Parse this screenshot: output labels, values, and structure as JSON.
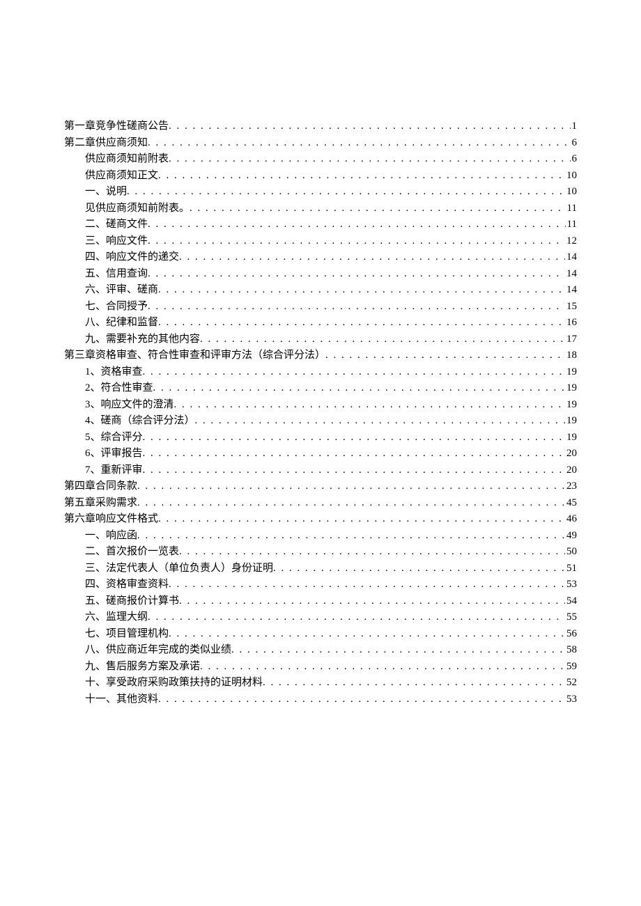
{
  "toc": [
    {
      "level": 1,
      "label": "第一章竞争性磋商公告",
      "page": "1"
    },
    {
      "level": 1,
      "label": "第二章供应商须知",
      "page": "6"
    },
    {
      "level": 2,
      "label": "供应商须知前附表",
      "page": "6"
    },
    {
      "level": 2,
      "label": "供应商须知正文",
      "page": "10"
    },
    {
      "level": 2,
      "label": "一、说明",
      "page": "10"
    },
    {
      "level": 2,
      "label": "见供应商须知前附表。",
      "page": "11"
    },
    {
      "level": 2,
      "label": "二、磋商文件",
      "page": "11"
    },
    {
      "level": 2,
      "label": "三、响应文件",
      "page": "12"
    },
    {
      "level": 2,
      "label": "四、响应文件的递交",
      "page": "14"
    },
    {
      "level": 2,
      "label": "五、信用查询",
      "page": "14"
    },
    {
      "level": 2,
      "label": "六、评审、磋商",
      "page": "14"
    },
    {
      "level": 2,
      "label": "七、合同授予",
      "page": "15"
    },
    {
      "level": 2,
      "label": "八、纪律和监督",
      "page": "16"
    },
    {
      "level": 2,
      "label": "九、需要补充的其他内容",
      "page": "17"
    },
    {
      "level": 1,
      "label": "第三章资格审查、符合性审查和评审方法（综合评分法）",
      "page": "18"
    },
    {
      "level": 2,
      "label": "1、资格审查",
      "page": "19"
    },
    {
      "level": 2,
      "label": "2、符合性审查",
      "page": "19"
    },
    {
      "level": 2,
      "label": "3、响应文件的澄清",
      "page": "19"
    },
    {
      "level": 2,
      "label": "4、磋商（综合评分法）",
      "page": "19"
    },
    {
      "level": 2,
      "label": "5、综合评分",
      "page": "19"
    },
    {
      "level": 2,
      "label": "6、评审报告",
      "page": "20"
    },
    {
      "level": 2,
      "label": "7、重新评审",
      "page": "20"
    },
    {
      "level": 1,
      "label": "第四章合同条款",
      "page": "23"
    },
    {
      "level": 1,
      "label": "第五章采购需求",
      "page": "45"
    },
    {
      "level": 1,
      "label": "第六章响应文件格式",
      "page": "46"
    },
    {
      "level": 2,
      "label": "一、响应函",
      "page": "49"
    },
    {
      "level": 2,
      "label": "二、首次报价一览表",
      "page": "50"
    },
    {
      "level": 2,
      "label": "三、法定代表人（单位负责人）身份证明",
      "page": "51"
    },
    {
      "level": 2,
      "label": "四、资格审查资料",
      "page": "53"
    },
    {
      "level": 2,
      "label": "五、磋商报价计算书",
      "page": "54"
    },
    {
      "level": 2,
      "label": "六、监理大纲",
      "page": "55"
    },
    {
      "level": 2,
      "label": "七、项目管理机构",
      "page": "56"
    },
    {
      "level": 2,
      "label": "八、供应商近年完成的类似业绩",
      "page": "58"
    },
    {
      "level": 2,
      "label": "九、售后服务方案及承诺",
      "page": "59"
    },
    {
      "level": 2,
      "label": "十、享受政府采购政策扶持的证明材料",
      "page": "52"
    },
    {
      "level": 2,
      "label": "十一、其他资料",
      "page": "53"
    }
  ]
}
